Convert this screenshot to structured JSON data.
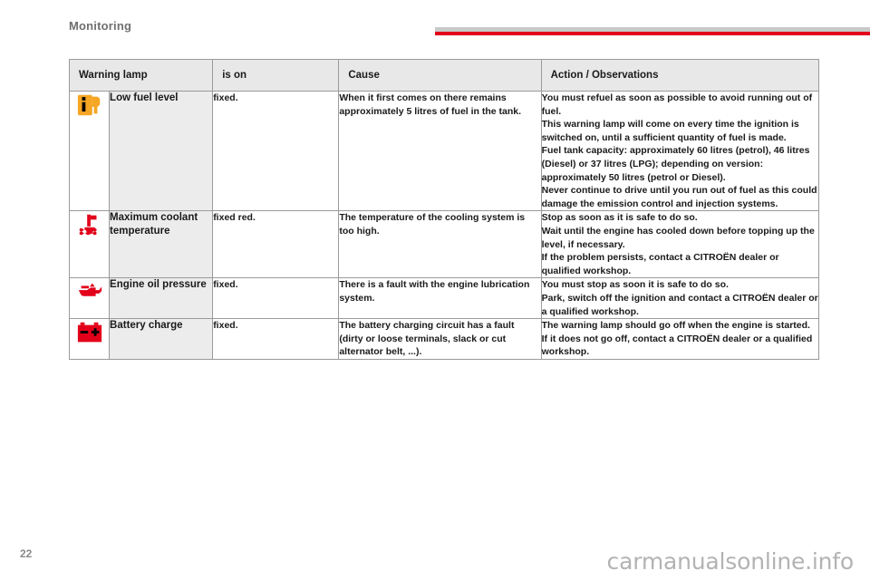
{
  "header": {
    "section_title": "Monitoring",
    "rule_grey_color": "#c9c9c9",
    "rule_red_color": "#e2001a"
  },
  "table": {
    "columns": [
      {
        "key": "icon",
        "label": ""
      },
      {
        "key": "name",
        "label": "Warning lamp"
      },
      {
        "key": "is_on",
        "label": "is on"
      },
      {
        "key": "cause",
        "label": "Cause"
      },
      {
        "key": "action",
        "label": "Action / Observations"
      }
    ],
    "rows": [
      {
        "icon_name": "low-fuel-level-lamp-icon",
        "icon_color": "#f5a623",
        "name": "Low fuel level",
        "is_on": "fixed.",
        "cause": "When it first comes on there remains approximately 5 litres of fuel in the tank.",
        "action_lines": [
          "You must refuel as soon as possible to avoid running out of fuel.",
          "This warning lamp will come on every time the ignition is switched on, until a sufficient quantity of fuel is made.",
          "Fuel tank capacity: approximately 60 litres (petrol), 46 litres (Diesel) or 37 litres (LPG); depending on version: approximately 50 litres (petrol or Diesel).",
          "Never continue to drive until you run out of fuel as this could damage the emission control and injection systems."
        ]
      },
      {
        "icon_name": "maximum-coolant-temperature-lamp-icon",
        "icon_color": "#e2001a",
        "name": "Maximum coolant temperature",
        "is_on": "fixed red.",
        "cause": "The temperature of the cooling system is too high.",
        "action_lines": [
          "Stop as soon as it is safe to do so.",
          "Wait until the engine has cooled down before topping up the level, if necessary.",
          "If the problem persists, contact a CITROËN dealer or qualified workshop."
        ]
      },
      {
        "icon_name": "engine-oil-pressure-lamp-icon",
        "icon_color": "#e2001a",
        "name": "Engine oil pressure",
        "is_on": "fixed.",
        "cause": "There is a fault with the engine lubrication system.",
        "action_lines": [
          "You must stop as soon it is safe to do so.",
          "Park, switch off the ignition and contact a CITROËN dealer or a qualified workshop."
        ]
      },
      {
        "icon_name": "battery-charge-lamp-icon",
        "icon_color": "#e2001a",
        "name": "Battery charge",
        "is_on": "fixed.",
        "cause": "The battery charging circuit has a fault (dirty or loose terminals, slack or cut alternator belt, ...).",
        "action_lines": [
          "The warning lamp should go off when the engine is started.",
          "If it does not go off, contact a CITROËN dealer or a qualified workshop."
        ]
      }
    ]
  },
  "footer": {
    "page_number": "22",
    "watermark": "carmanualsonline.info"
  }
}
